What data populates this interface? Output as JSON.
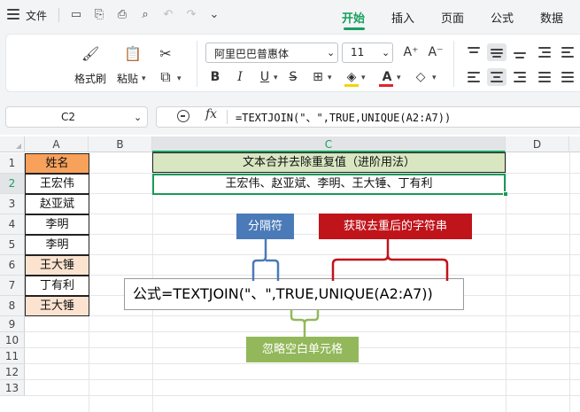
{
  "menubar": {
    "file_label": "文件",
    "tabs": [
      {
        "label": "开始",
        "active": true
      },
      {
        "label": "插入",
        "active": false
      },
      {
        "label": "页面",
        "active": false
      },
      {
        "label": "公式",
        "active": false
      },
      {
        "label": "数据",
        "active": false
      }
    ],
    "accent_color": "#17a05d"
  },
  "ribbon": {
    "format_painter_label": "格式刷",
    "paste_label": "粘贴",
    "font_name": "阿里巴巴普惠体",
    "font_size": "11"
  },
  "formula_bar": {
    "cell_ref": "C2",
    "fx_label": "fx",
    "formula": "=TEXTJOIN(\"、\",TRUE,UNIQUE(A2:A7))"
  },
  "sheet": {
    "columns": [
      "A",
      "B",
      "C",
      "D"
    ],
    "selected_column": "C",
    "rows": [
      "1",
      "2",
      "3",
      "4",
      "5",
      "6",
      "7",
      "8",
      "9",
      "10",
      "11",
      "12",
      "13"
    ],
    "selected_row": "2",
    "col_a": [
      "姓名",
      "王宏伟",
      "赵亚斌",
      "李明",
      "李明",
      "王大锤",
      "丁有利",
      "王大锤"
    ],
    "c1_title": "文本合并去除重复值（进阶用法）",
    "c2_result": "王宏伟、赵亚斌、李明、王大锤、丁有利"
  },
  "annotations": {
    "separator_label": "分隔符",
    "unique_label": "获取去重后的字符串",
    "ignore_blank_label": "忽略空白单元格",
    "formula_display": "公式=TEXTJOIN(\"、\",TRUE,UNIQUE(A2:A7))",
    "colors": {
      "blue": "#4a7ab8",
      "red": "#c0141b",
      "green": "#93b85b"
    }
  }
}
